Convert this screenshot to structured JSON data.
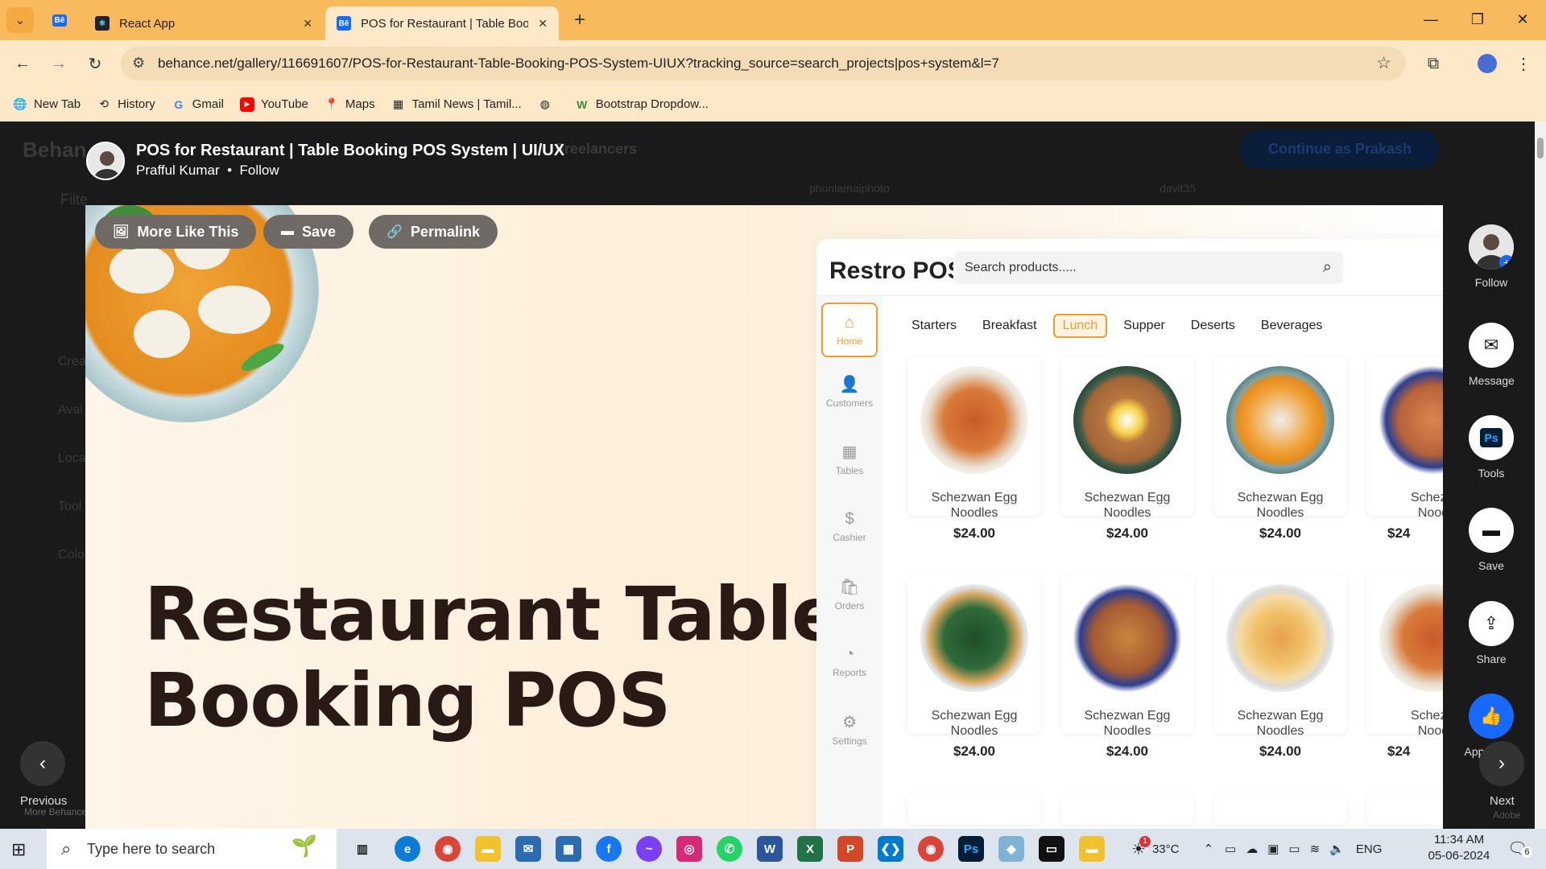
{
  "browser": {
    "tabs": [
      {
        "title": "React App",
        "favicon": "react-icon"
      },
      {
        "title": "POS for Restaurant | Table Book",
        "favicon": "behance-icon"
      }
    ],
    "new_tab_label": "+",
    "url": "behance.net/gallery/116691607/POS-for-Restaurant-Table-Booking-POS-System-UIUX?tracking_source=search_projects|pos+system&l=7",
    "bookmarks": [
      "New Tab",
      "History",
      "Gmail",
      "YouTube",
      "Maps",
      "Tamil News | Tamil...",
      "",
      "Bootstrap Dropdow..."
    ]
  },
  "background": {
    "behance_logo": "Behan",
    "freelancers": "Freelancers",
    "filter": "Filte",
    "left_items": [
      "Crea",
      "Avai",
      "Loca",
      "Tool",
      "Colo"
    ],
    "continue_button": "Continue as Prakash",
    "user1": "phonlamaiphoto",
    "user2": "davit35",
    "more_behance": "More Behance"
  },
  "project": {
    "title": "POS for Restaurant | Table Booking POS System | UI/UX",
    "author": "Prafful Kumar",
    "separator": "•",
    "follow_label": "Follow",
    "actions": {
      "more_like_this": "More Like This",
      "save": "Save",
      "permalink": "Permalink"
    },
    "hero_line1": "Restaurant Table",
    "hero_line2": "Booking POS"
  },
  "pos_app": {
    "brand": "Restro POS",
    "search_placeholder": "Search products.....",
    "sidebar": [
      "Home",
      "Customers",
      "Tables",
      "Cashier",
      "Orders",
      "Reports",
      "Settings"
    ],
    "categories": [
      "Starters",
      "Breakfast",
      "Lunch",
      "Supper",
      "Deserts",
      "Beverages"
    ],
    "active_category": "Lunch",
    "item_name_line1": "Schezwan Egg",
    "item_name_line2": "Noodles",
    "item_name_partial_line1": "Schezw",
    "item_name_partial_line2": "Nood",
    "item_price": "$24.00",
    "item_price_partial": "$24",
    "accent_color": "#f59a2e"
  },
  "right_rail": {
    "follow": "Follow",
    "message": "Message",
    "tools": "Tools",
    "tools_badge": "Ps",
    "save": "Save",
    "share": "Share",
    "appreciate": "Appreciate",
    "next": "Next",
    "adobe": "Adobe"
  },
  "nav": {
    "previous": "Previous"
  },
  "taskbar": {
    "search_placeholder": "Type here to search",
    "weather": "33°C",
    "weather_badge": "1",
    "lang": "ENG",
    "time": "11:34 AM",
    "date": "05-06-2024",
    "notifications": "6"
  }
}
